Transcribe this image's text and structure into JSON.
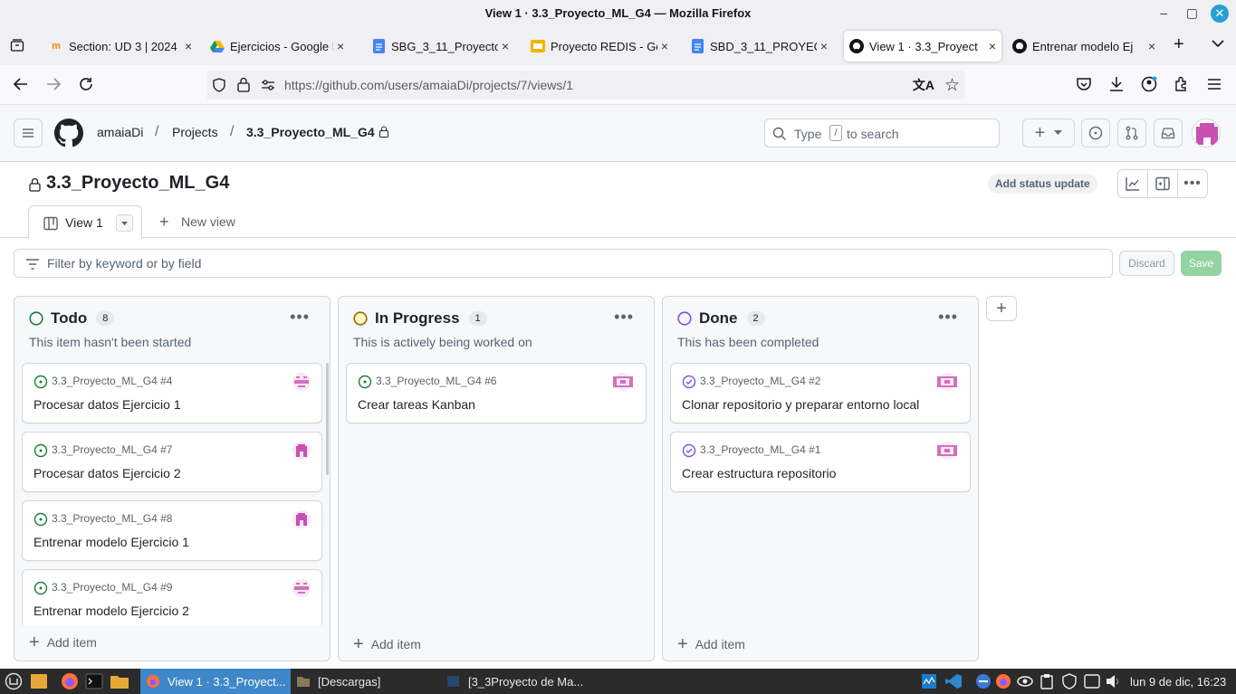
{
  "window": {
    "title": "View 1 · 3.3_Proyecto_ML_G4 — Mozilla Firefox"
  },
  "tabs": [
    {
      "label": "Section: UD 3 | 2024",
      "icon": "moodle-icon"
    },
    {
      "label": "Ejercicios - Google D",
      "icon": "google-drive-icon"
    },
    {
      "label": "SBG_3_11_Proyecto",
      "icon": "google-docs-icon"
    },
    {
      "label": "Proyecto REDIS - Go",
      "icon": "google-slides-icon"
    },
    {
      "label": "SBD_3_11_PROYEC",
      "icon": "google-docs-icon"
    },
    {
      "label": "View 1 · 3.3_Proyect",
      "icon": "github-icon"
    },
    {
      "label": "Entrenar modelo Ej",
      "icon": "github-icon"
    }
  ],
  "url": "https://github.com/users/amaiaDi/projects/7/views/1",
  "gh": {
    "breadcrumb_user": "amaiaDi",
    "breadcrumb_sep": "/",
    "breadcrumb_projects": "Projects",
    "breadcrumb_project": "3.3_Proyecto_ML_G4",
    "search_prefix": "Type",
    "search_key": "/",
    "search_suffix": "to search"
  },
  "project": {
    "title": "3.3_Proyecto_ML_G4",
    "status_button": "Add status update",
    "view_tab": "View 1",
    "new_view": "New view"
  },
  "filter": {
    "placeholder": "Filter by keyword or by field",
    "discard": "Discard",
    "save": "Save"
  },
  "columns": [
    {
      "name": "Todo",
      "count": "8",
      "desc": "This item hasn't been started",
      "status_color": "#1a7f37",
      "cards": [
        {
          "ref": "3.3_Proyecto_ML_G4 #4",
          "title": "Procesar datos Ejercicio 1"
        },
        {
          "ref": "3.3_Proyecto_ML_G4 #7",
          "title": "Procesar datos Ejercicio 2"
        },
        {
          "ref": "3.3_Proyecto_ML_G4 #8",
          "title": "Entrenar modelo Ejercicio 1"
        },
        {
          "ref": "3.3_Proyecto_ML_G4 #9",
          "title": "Entrenar modelo Ejercicio 2"
        }
      ],
      "add": "Add item"
    },
    {
      "name": "In Progress",
      "count": "1",
      "desc": "This is actively being worked on",
      "status_color": "#bf8700",
      "cards": [
        {
          "ref": "3.3_Proyecto_ML_G4 #6",
          "title": "Crear tareas Kanban"
        }
      ],
      "add": "Add item"
    },
    {
      "name": "Done",
      "count": "2",
      "desc": "This has been completed",
      "status_color": "#8250df",
      "cards": [
        {
          "ref": "3.3_Proyecto_ML_G4 #2",
          "title": "Clonar repositorio y preparar entorno local"
        },
        {
          "ref": "3.3_Proyecto_ML_G4 #1",
          "title": "Crear estructura repositorio"
        }
      ],
      "add": "Add item"
    }
  ],
  "taskbar": {
    "firefox_window": "View 1 · 3.3_Proyect...",
    "files_window": "[Descargas]",
    "vm_window": "[3_3Proyecto de Ma...",
    "clock": "lun  9 de dic, 16:23"
  }
}
